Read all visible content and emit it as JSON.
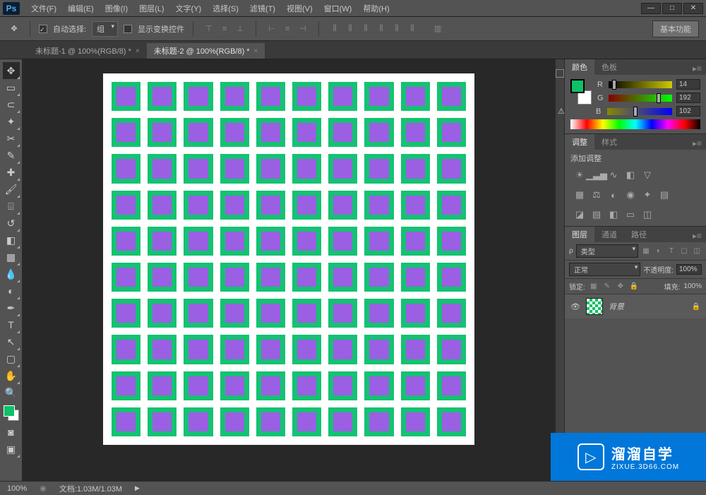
{
  "app": {
    "logo_text": "Ps"
  },
  "menu": [
    "文件(F)",
    "编辑(E)",
    "图像(I)",
    "图层(L)",
    "文字(Y)",
    "选择(S)",
    "滤镜(T)",
    "视图(V)",
    "窗口(W)",
    "帮助(H)"
  ],
  "window_controls": {
    "min": "—",
    "max": "□",
    "close": "✕"
  },
  "options": {
    "auto_select_label": "自动选择:",
    "group_label": "组",
    "show_transform_label": "显示变换控件",
    "basic_btn": "基本功能"
  },
  "tabs": [
    {
      "label": "未标题-1 @ 100%(RGB/8) *",
      "active": false
    },
    {
      "label": "未标题-2 @ 100%(RGB/8) *",
      "active": true
    }
  ],
  "tools": [
    "move",
    "marquee",
    "lasso",
    "wand",
    "crop",
    "eyedropper",
    "heal",
    "brush",
    "stamp",
    "history",
    "eraser",
    "gradient",
    "blur",
    "dodge",
    "pen",
    "type",
    "path",
    "shape",
    "hand",
    "zoom"
  ],
  "panels": {
    "color": {
      "tabs": [
        "颜色",
        "色板"
      ],
      "r_label": "R",
      "r_value": "14",
      "g_label": "G",
      "g_value": "192",
      "b_label": "B",
      "b_value": "102",
      "warn": "⚠"
    },
    "adjust": {
      "tabs": [
        "调整",
        "样式"
      ],
      "header": "添加调整"
    },
    "layers": {
      "tabs": [
        "图层",
        "通道",
        "路径"
      ],
      "kind_label": "类型",
      "blend_label": "正常",
      "opacity_label": "不透明度:",
      "opacity_value": "100%",
      "lock_label": "锁定:",
      "fill_label": "填充:",
      "fill_value": "100%",
      "layer_name": "背景"
    }
  },
  "status": {
    "zoom": "100%",
    "doc_label": "文档:",
    "doc_size": "1.03M/1.03M"
  },
  "watermark": {
    "main": "溜溜自学",
    "sub": "ZIXUE.3D66.COM",
    "play": "▷"
  },
  "canvas_colors": {
    "outer": "#15c273",
    "inner": "#9b5fe3"
  }
}
